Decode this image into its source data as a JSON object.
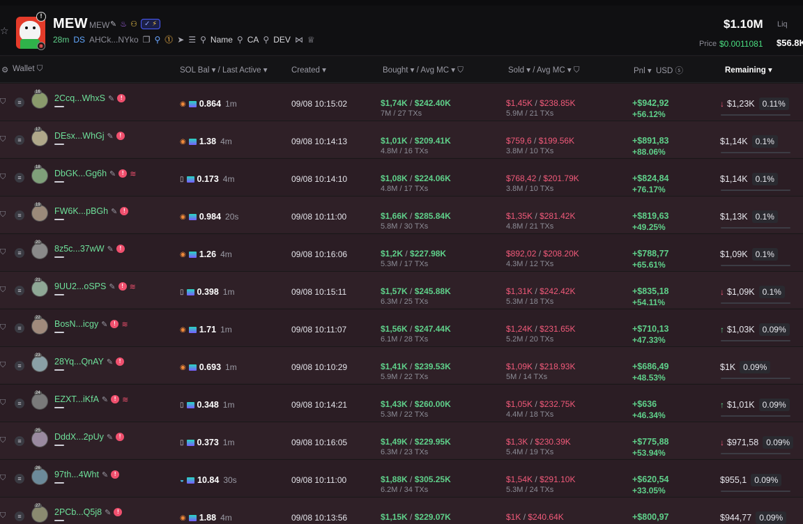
{
  "header": {
    "ticker": "MEW",
    "ticker_sub": "MEW",
    "age": "28m",
    "ds": "DS",
    "address": "AHCk...NYko",
    "links": [
      "Name",
      "CA",
      "DEV"
    ],
    "market_cap": "$1.10M",
    "price_label": "Price",
    "price": "$0.0011081",
    "liq_label": "Liq",
    "liq": "$56.8K"
  },
  "columns": {
    "wallet": "Wallet",
    "sol_bal": "SOL Bal",
    "last_active": "Last Active",
    "created": "Created",
    "bought": "Bought",
    "avg_mc_b": "Avg MC",
    "sold": "Sold",
    "avg_mc_s": "Avg MC",
    "pnl": "Pnl",
    "usd": "USD",
    "remaining": "Remaining"
  },
  "rows": [
    {
      "rank": "16",
      "wallet": "2Ccq...WhxS",
      "src": "orange",
      "sol": "0.864",
      "ago": "1m",
      "created": "09/08 10:15:02",
      "bought": "$1,74K",
      "bought_mc": "$242.40K",
      "bought_sub": "7M / 27 TXs",
      "sold": "$1,45K",
      "sold_mc": "$238.85K",
      "sold_sub": "5.9M / 21 TXs",
      "pnl": "+$942,92",
      "pnl_pct": "+56.12%",
      "arrow": "down",
      "remain": "$1,23K",
      "remain_pct": "0.11%",
      "stack": false
    },
    {
      "rank": "17",
      "wallet": "DEsx...WhGj",
      "src": "orange",
      "sol": "1.38",
      "ago": "4m",
      "created": "09/08 10:14:13",
      "bought": "$1,01K",
      "bought_mc": "$209.41K",
      "bought_sub": "4.8M / 16 TXs",
      "sold": "$759,6",
      "sold_mc": "$199.56K",
      "sold_sub": "3.8M / 10 TXs",
      "pnl": "+$891,83",
      "pnl_pct": "+88.06%",
      "arrow": "",
      "remain": "$1,14K",
      "remain_pct": "0.1%",
      "stack": false
    },
    {
      "rank": "18",
      "wallet": "DbGK...Gg6h",
      "src": "box",
      "sol": "0.173",
      "ago": "4m",
      "created": "09/08 10:14:10",
      "bought": "$1,08K",
      "bought_mc": "$224.06K",
      "bought_sub": "4.8M / 17 TXs",
      "sold": "$768,42",
      "sold_mc": "$201.79K",
      "sold_sub": "3.8M / 10 TXs",
      "pnl": "+$824,84",
      "pnl_pct": "+76.17%",
      "arrow": "",
      "remain": "$1,14K",
      "remain_pct": "0.1%",
      "stack": true
    },
    {
      "rank": "19",
      "wallet": "FW6K...pBGh",
      "src": "orange",
      "sol": "0.984",
      "ago": "20s",
      "created": "09/08 10:11:00",
      "bought": "$1,66K",
      "bought_mc": "$285.84K",
      "bought_sub": "5.8M / 30 TXs",
      "sold": "$1,35K",
      "sold_mc": "$281.42K",
      "sold_sub": "4.8M / 21 TXs",
      "pnl": "+$819,63",
      "pnl_pct": "+49.25%",
      "arrow": "",
      "remain": "$1,13K",
      "remain_pct": "0.1%",
      "stack": false
    },
    {
      "rank": "20",
      "wallet": "8z5c...37wW",
      "src": "orange",
      "sol": "1.26",
      "ago": "4m",
      "created": "09/08 10:16:06",
      "bought": "$1,2K",
      "bought_mc": "$227.98K",
      "bought_sub": "5.3M / 17 TXs",
      "sold": "$892,02",
      "sold_mc": "$208.20K",
      "sold_sub": "4.3M / 12 TXs",
      "pnl": "+$788,77",
      "pnl_pct": "+65.61%",
      "arrow": "",
      "remain": "$1,09K",
      "remain_pct": "0.1%",
      "stack": false
    },
    {
      "rank": "21",
      "wallet": "9UU2...oSPS",
      "src": "box",
      "sol": "0.398",
      "ago": "1m",
      "created": "09/08 10:15:11",
      "bought": "$1,57K",
      "bought_mc": "$245.88K",
      "bought_sub": "6.3M / 25 TXs",
      "sold": "$1,31K",
      "sold_mc": "$242.42K",
      "sold_sub": "5.3M / 18 TXs",
      "pnl": "+$835,18",
      "pnl_pct": "+54.11%",
      "arrow": "down",
      "remain": "$1,09K",
      "remain_pct": "0.1%",
      "stack": true
    },
    {
      "rank": "22",
      "wallet": "BosN...icgy",
      "src": "orange",
      "sol": "1.71",
      "ago": "1m",
      "created": "09/08 10:11:07",
      "bought": "$1,56K",
      "bought_mc": "$247.44K",
      "bought_sub": "6.1M / 28 TXs",
      "sold": "$1,24K",
      "sold_mc": "$231.65K",
      "sold_sub": "5.2M / 20 TXs",
      "pnl": "+$710,13",
      "pnl_pct": "+47.33%",
      "arrow": "up",
      "remain": "$1,03K",
      "remain_pct": "0.09%",
      "stack": true
    },
    {
      "rank": "23",
      "wallet": "28Yq...QnAY",
      "src": "orange",
      "sol": "0.693",
      "ago": "1m",
      "created": "09/08 10:10:29",
      "bought": "$1,41K",
      "bought_mc": "$239.53K",
      "bought_sub": "5.9M / 22 TXs",
      "sold": "$1,09K",
      "sold_mc": "$218.93K",
      "sold_sub": "5M / 14 TXs",
      "pnl": "+$686,49",
      "pnl_pct": "+48.53%",
      "arrow": "",
      "remain": "$1K",
      "remain_pct": "0.09%",
      "stack": false
    },
    {
      "rank": "24",
      "wallet": "EZXT...iKfA",
      "src": "box",
      "sol": "0.348",
      "ago": "1m",
      "created": "09/08 10:14:21",
      "bought": "$1,43K",
      "bought_mc": "$260.00K",
      "bought_sub": "5.3M / 22 TXs",
      "sold": "$1,05K",
      "sold_mc": "$232.75K",
      "sold_sub": "4.4M / 18 TXs",
      "pnl": "+$636",
      "pnl_pct": "+46.34%",
      "arrow": "up",
      "remain": "$1,01K",
      "remain_pct": "0.09%",
      "stack": true
    },
    {
      "rank": "25",
      "wallet": "DddX...2pUy",
      "src": "box",
      "sol": "0.373",
      "ago": "1m",
      "created": "09/08 10:16:05",
      "bought": "$1,49K",
      "bought_mc": "$229.95K",
      "bought_sub": "6.3M / 23 TXs",
      "sold": "$1,3K",
      "sold_mc": "$230.39K",
      "sold_sub": "5.4M / 19 TXs",
      "pnl": "+$775,88",
      "pnl_pct": "+53.94%",
      "arrow": "down",
      "remain": "$971,58",
      "remain_pct": "0.09%",
      "stack": false
    },
    {
      "rank": "26",
      "wallet": "97th...4Wht",
      "src": "fish",
      "sol": "10.84",
      "ago": "30s",
      "created": "09/08 10:11:00",
      "bought": "$1,88K",
      "bought_mc": "$305.25K",
      "bought_sub": "6.2M / 34 TXs",
      "sold": "$1,54K",
      "sold_mc": "$291.10K",
      "sold_sub": "5.3M / 24 TXs",
      "pnl": "+$620,54",
      "pnl_pct": "+33.05%",
      "arrow": "",
      "remain": "$955,1",
      "remain_pct": "0.09%",
      "stack": false
    },
    {
      "rank": "27",
      "wallet": "2PCb...Q5j8",
      "src": "orange",
      "sol": "1.88",
      "ago": "4m",
      "created": "09/08 10:13:56",
      "bought": "$1,15K",
      "bought_mc": "$229.07K",
      "bought_sub": "",
      "sold": "$1K",
      "sold_mc": "$240.64K",
      "sold_sub": "",
      "pnl": "+$800,97",
      "pnl_pct": "",
      "arrow": "",
      "remain": "$944,77",
      "remain_pct": "0.09%",
      "stack": false
    }
  ]
}
